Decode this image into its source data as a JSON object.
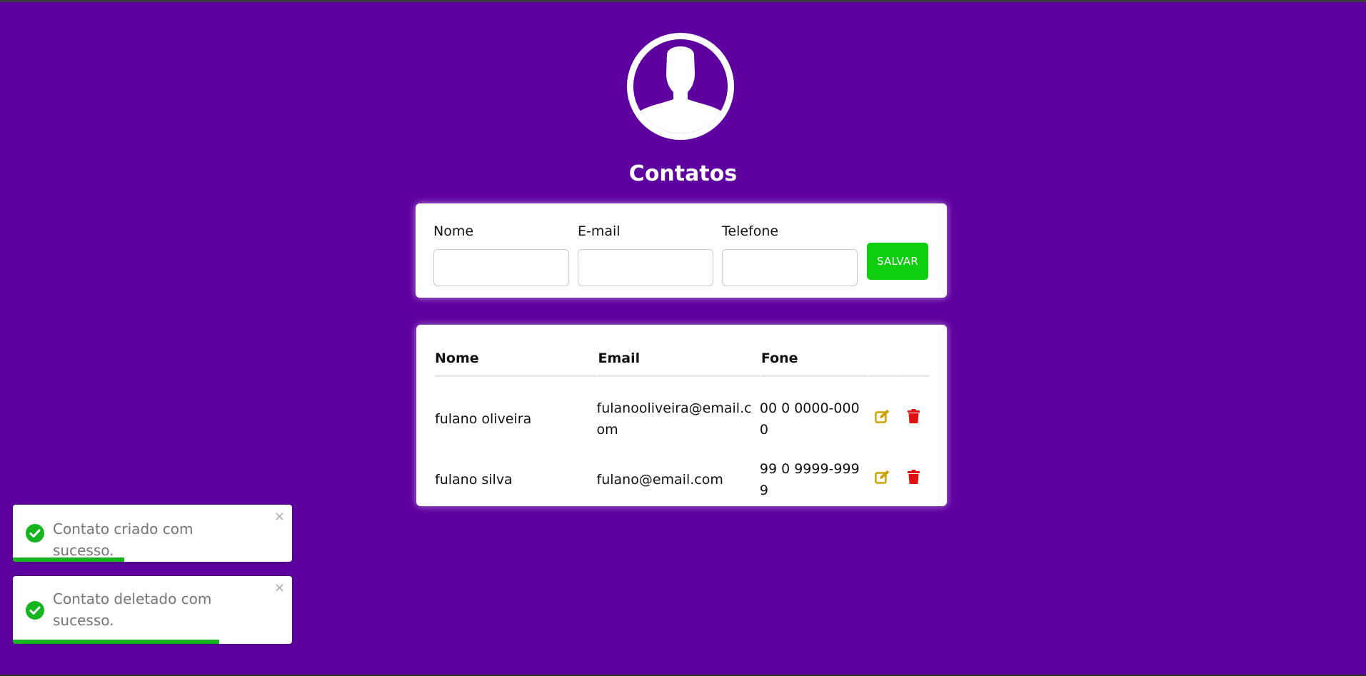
{
  "page": {
    "title": "Contatos",
    "background_color": "#5e009f"
  },
  "avatar": {
    "icon": "user-avatar-icon"
  },
  "form": {
    "fields": [
      {
        "label": "Nome",
        "value": "",
        "placeholder": ""
      },
      {
        "label": "E-mail",
        "value": "",
        "placeholder": ""
      },
      {
        "label": "Telefone",
        "value": "",
        "placeholder": ""
      }
    ],
    "save_label": "SALVAR",
    "save_color": "#0fce0f"
  },
  "table": {
    "headers": [
      "Nome",
      "Email",
      "Fone"
    ],
    "rows": [
      {
        "nome": "fulano oliveira",
        "email": "fulanooliveira@email.com",
        "fone": "00 0 0000-0000"
      },
      {
        "nome": "fulano silva",
        "email": "fulano@email.com",
        "fone": "99 0 9999-9999"
      }
    ],
    "edit_icon": "edit-icon",
    "delete_icon": "trash-icon",
    "edit_color": "#c9a200",
    "delete_color": "#e01010"
  },
  "toasts": [
    {
      "message": "Contato criado com sucesso.",
      "close_glyph": "×",
      "progress_percent": 40
    },
    {
      "message": "Contato deletado com sucesso.",
      "close_glyph": "×",
      "progress_percent": 74
    }
  ],
  "status_colors": {
    "success": "#16b41e"
  }
}
